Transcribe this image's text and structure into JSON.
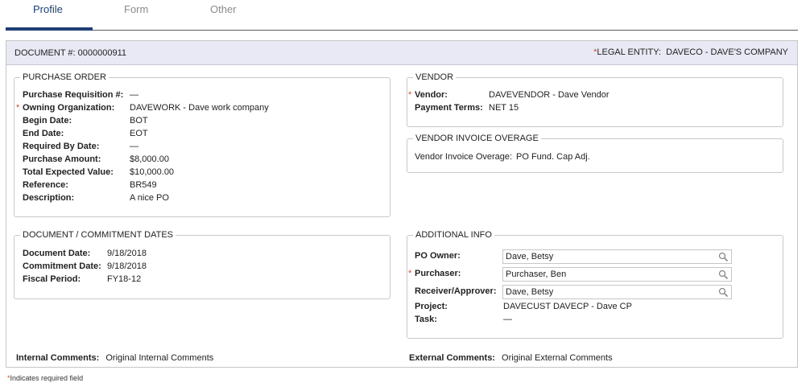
{
  "tabs": [
    {
      "label": "Profile"
    },
    {
      "label": "Form"
    },
    {
      "label": "Other"
    }
  ],
  "header": {
    "document_label": "DOCUMENT #:",
    "document_number": "0000000911",
    "required_marker": "*",
    "legal_entity_label": "LEGAL ENTITY:",
    "legal_entity_value": "DAVECO - DAVE'S COMPANY"
  },
  "purchase_order": {
    "title": "PURCHASE ORDER",
    "fields": [
      {
        "label": "Purchase Requisition #:",
        "value": "—",
        "required": false
      },
      {
        "label": "Owning Organization:",
        "value": "DAVEWORK - Dave work company",
        "required": true
      },
      {
        "label": "Begin Date:",
        "value": "BOT",
        "required": false
      },
      {
        "label": "End Date:",
        "value": "EOT",
        "required": false
      },
      {
        "label": "Required By Date:",
        "value": "—",
        "required": false
      },
      {
        "label": "Purchase Amount:",
        "value": "$8,000.00",
        "required": false
      },
      {
        "label": "Total Expected Value:",
        "value": "$10,000.00",
        "required": false
      },
      {
        "label": "Reference:",
        "value": "BR549",
        "required": false
      },
      {
        "label": "Description:",
        "value": "A nice PO",
        "required": false
      }
    ]
  },
  "vendor": {
    "title": "VENDOR",
    "vendor_label": "Vendor:",
    "vendor_value": "DAVEVENDOR - Dave Vendor",
    "terms_label": "Payment Terms:",
    "terms_value": "NET 15"
  },
  "vendor_overage": {
    "title": "VENDOR INVOICE OVERAGE",
    "label": "Vendor Invoice Overage:",
    "value": "PO Fund. Cap Adj."
  },
  "dates": {
    "title": "DOCUMENT / COMMITMENT DATES",
    "fields": [
      {
        "label": "Document Date:",
        "value": "9/18/2018"
      },
      {
        "label": "Commitment Date:",
        "value": "9/18/2018"
      },
      {
        "label": "Fiscal Period:",
        "value": "FY18-12"
      }
    ]
  },
  "additional": {
    "title": "ADDITIONAL INFO",
    "po_owner_label": "PO Owner:",
    "po_owner_value": "Dave, Betsy",
    "purchaser_label": "Purchaser:",
    "purchaser_value": "Purchaser, Ben",
    "receiver_label": "Receiver/Approver:",
    "receiver_value": "Dave, Betsy",
    "project_label": "Project:",
    "project_value": "DAVECUST DAVECP - Dave CP",
    "task_label": "Task:",
    "task_value": "—"
  },
  "comments": {
    "internal_label": "Internal Comments:",
    "internal_value": "Original Internal Comments",
    "external_label": "External Comments:",
    "external_value": "Original External Comments"
  },
  "footnote": {
    "marker": "*",
    "text": "Indicates required field"
  },
  "colors": {
    "tab_active": "#1f3f73",
    "header_bg": "#e9e9f5",
    "required": "#d04a2a"
  }
}
